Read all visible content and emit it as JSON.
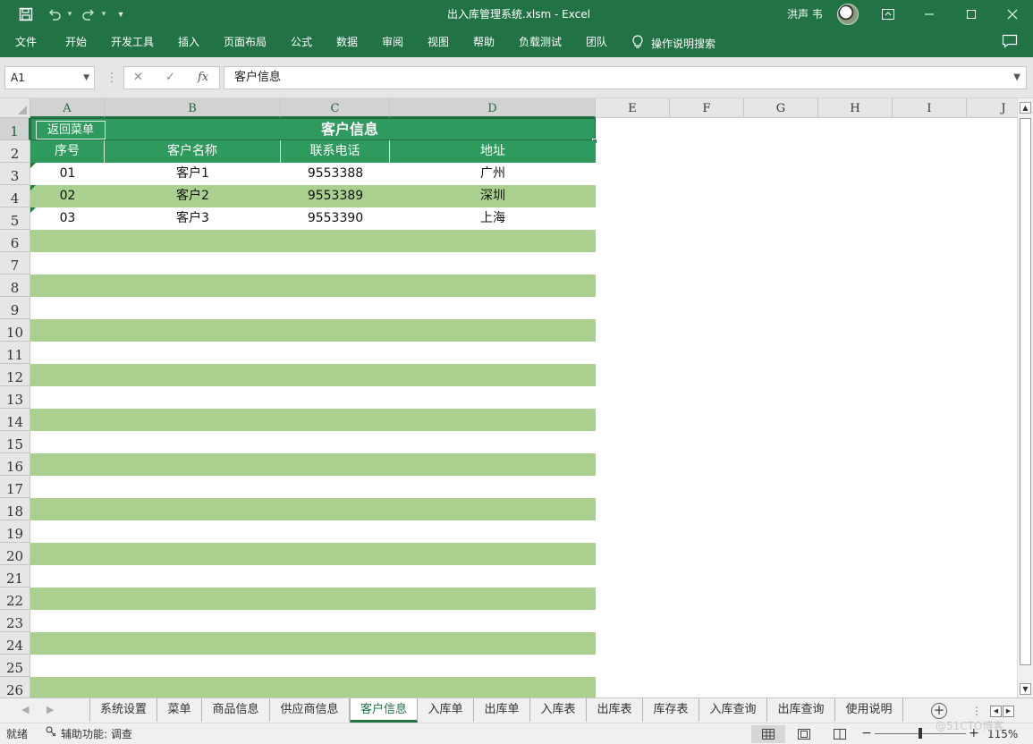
{
  "window": {
    "title": "出入库管理系统.xlsm  -  Excel",
    "user_name": "洪声 韦",
    "quick_access": {
      "save_icon": "save-icon",
      "undo_icon": "undo-icon",
      "redo_icon": "redo-icon",
      "customize": "▾"
    }
  },
  "ribbon": {
    "tabs": [
      "文件",
      "开始",
      "开发工具",
      "插入",
      "页面布局",
      "公式",
      "数据",
      "审阅",
      "视图",
      "帮助",
      "负载测试",
      "团队"
    ],
    "tell_me": "操作说明搜索"
  },
  "formula_bar": {
    "name_box": "A1",
    "fx": "fx",
    "content": "客户信息"
  },
  "columns": [
    "A",
    "B",
    "C",
    "D",
    "E",
    "F",
    "G",
    "H",
    "I",
    "J"
  ],
  "rows": [
    "1",
    "2",
    "3",
    "4",
    "5",
    "6",
    "7",
    "8",
    "9",
    "10",
    "11",
    "12",
    "13",
    "14",
    "15",
    "16",
    "17",
    "18",
    "19",
    "20",
    "21",
    "22",
    "23",
    "24",
    "25",
    "26"
  ],
  "sheet": {
    "title": "客户信息",
    "back_button": "返回菜单",
    "headers": [
      "序号",
      "客户名称",
      "联系电话",
      "地址"
    ],
    "records": [
      [
        "01",
        "客户1",
        "9553388",
        "广州"
      ],
      [
        "02",
        "客户2",
        "9553389",
        "深圳"
      ],
      [
        "03",
        "客户3",
        "9553390",
        "上海"
      ]
    ]
  },
  "sheet_tabs": {
    "tabs": [
      "系统设置",
      "菜单",
      "商品信息",
      "供应商信息",
      "客户信息",
      "入库单",
      "出库单",
      "入库表",
      "出库表",
      "库存表",
      "入库查询",
      "出库查询",
      "使用说明"
    ],
    "active": "客户信息"
  },
  "status_bar": {
    "ready": "就绪",
    "accessibility": "辅助功能: 调查",
    "zoom": "115%"
  },
  "watermark": "@51CTO博客",
  "colors": {
    "excel_green": "#217346",
    "header_green": "#2e9a5e",
    "band_green": "#a9d08e"
  }
}
